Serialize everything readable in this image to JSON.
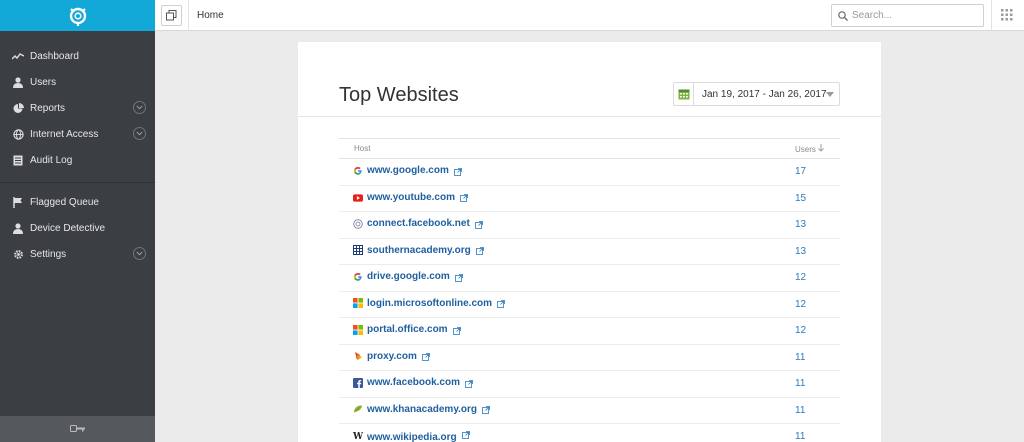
{
  "sidebar": {
    "items": [
      {
        "label": "Dashboard",
        "icon": "trend-line-icon",
        "expandable": false
      },
      {
        "label": "Users",
        "icon": "user-icon",
        "expandable": false
      },
      {
        "label": "Reports",
        "icon": "pie-chart-icon",
        "expandable": true
      },
      {
        "label": "Internet Access",
        "icon": "globe-icon",
        "expandable": true
      },
      {
        "label": "Audit Log",
        "icon": "document-icon",
        "expandable": false
      }
    ],
    "items2": [
      {
        "label": "Flagged Queue",
        "icon": "flag-icon",
        "expandable": false
      },
      {
        "label": "Device Detective",
        "icon": "user-icon",
        "expandable": false
      },
      {
        "label": "Settings",
        "icon": "gear-icon",
        "expandable": true
      }
    ]
  },
  "topbar": {
    "breadcrumb": "Home",
    "search_placeholder": "Search..."
  },
  "main": {
    "title": "Top Websites",
    "date_range": "Jan 19, 2017 - Jan 26, 2017",
    "table": {
      "headers": {
        "host": "Host",
        "users": "Users"
      },
      "rows": [
        {
          "host": "www.google.com",
          "users": "17",
          "favicon": "google"
        },
        {
          "host": "www.youtube.com",
          "users": "15",
          "favicon": "youtube"
        },
        {
          "host": "connect.facebook.net",
          "users": "13",
          "favicon": "generic"
        },
        {
          "host": "southernacademy.org",
          "users": "13",
          "favicon": "grid"
        },
        {
          "host": "drive.google.com",
          "users": "12",
          "favicon": "google"
        },
        {
          "host": "login.microsoftonline.com",
          "users": "12",
          "favicon": "microsoft"
        },
        {
          "host": "portal.office.com",
          "users": "12",
          "favicon": "microsoft"
        },
        {
          "host": "proxy.com",
          "users": "11",
          "favicon": "proxy"
        },
        {
          "host": "www.facebook.com",
          "users": "11",
          "favicon": "facebook"
        },
        {
          "host": "www.khanacademy.org",
          "users": "11",
          "favicon": "khan"
        },
        {
          "host": "www.wikipedia.org",
          "users": "11",
          "favicon": "wikipedia"
        }
      ]
    }
  },
  "colors": {
    "brand": "#12a9d8",
    "sidebar_bg": "#3b3f44",
    "link": "#1f5f9e",
    "count": "#2a7bbf"
  }
}
